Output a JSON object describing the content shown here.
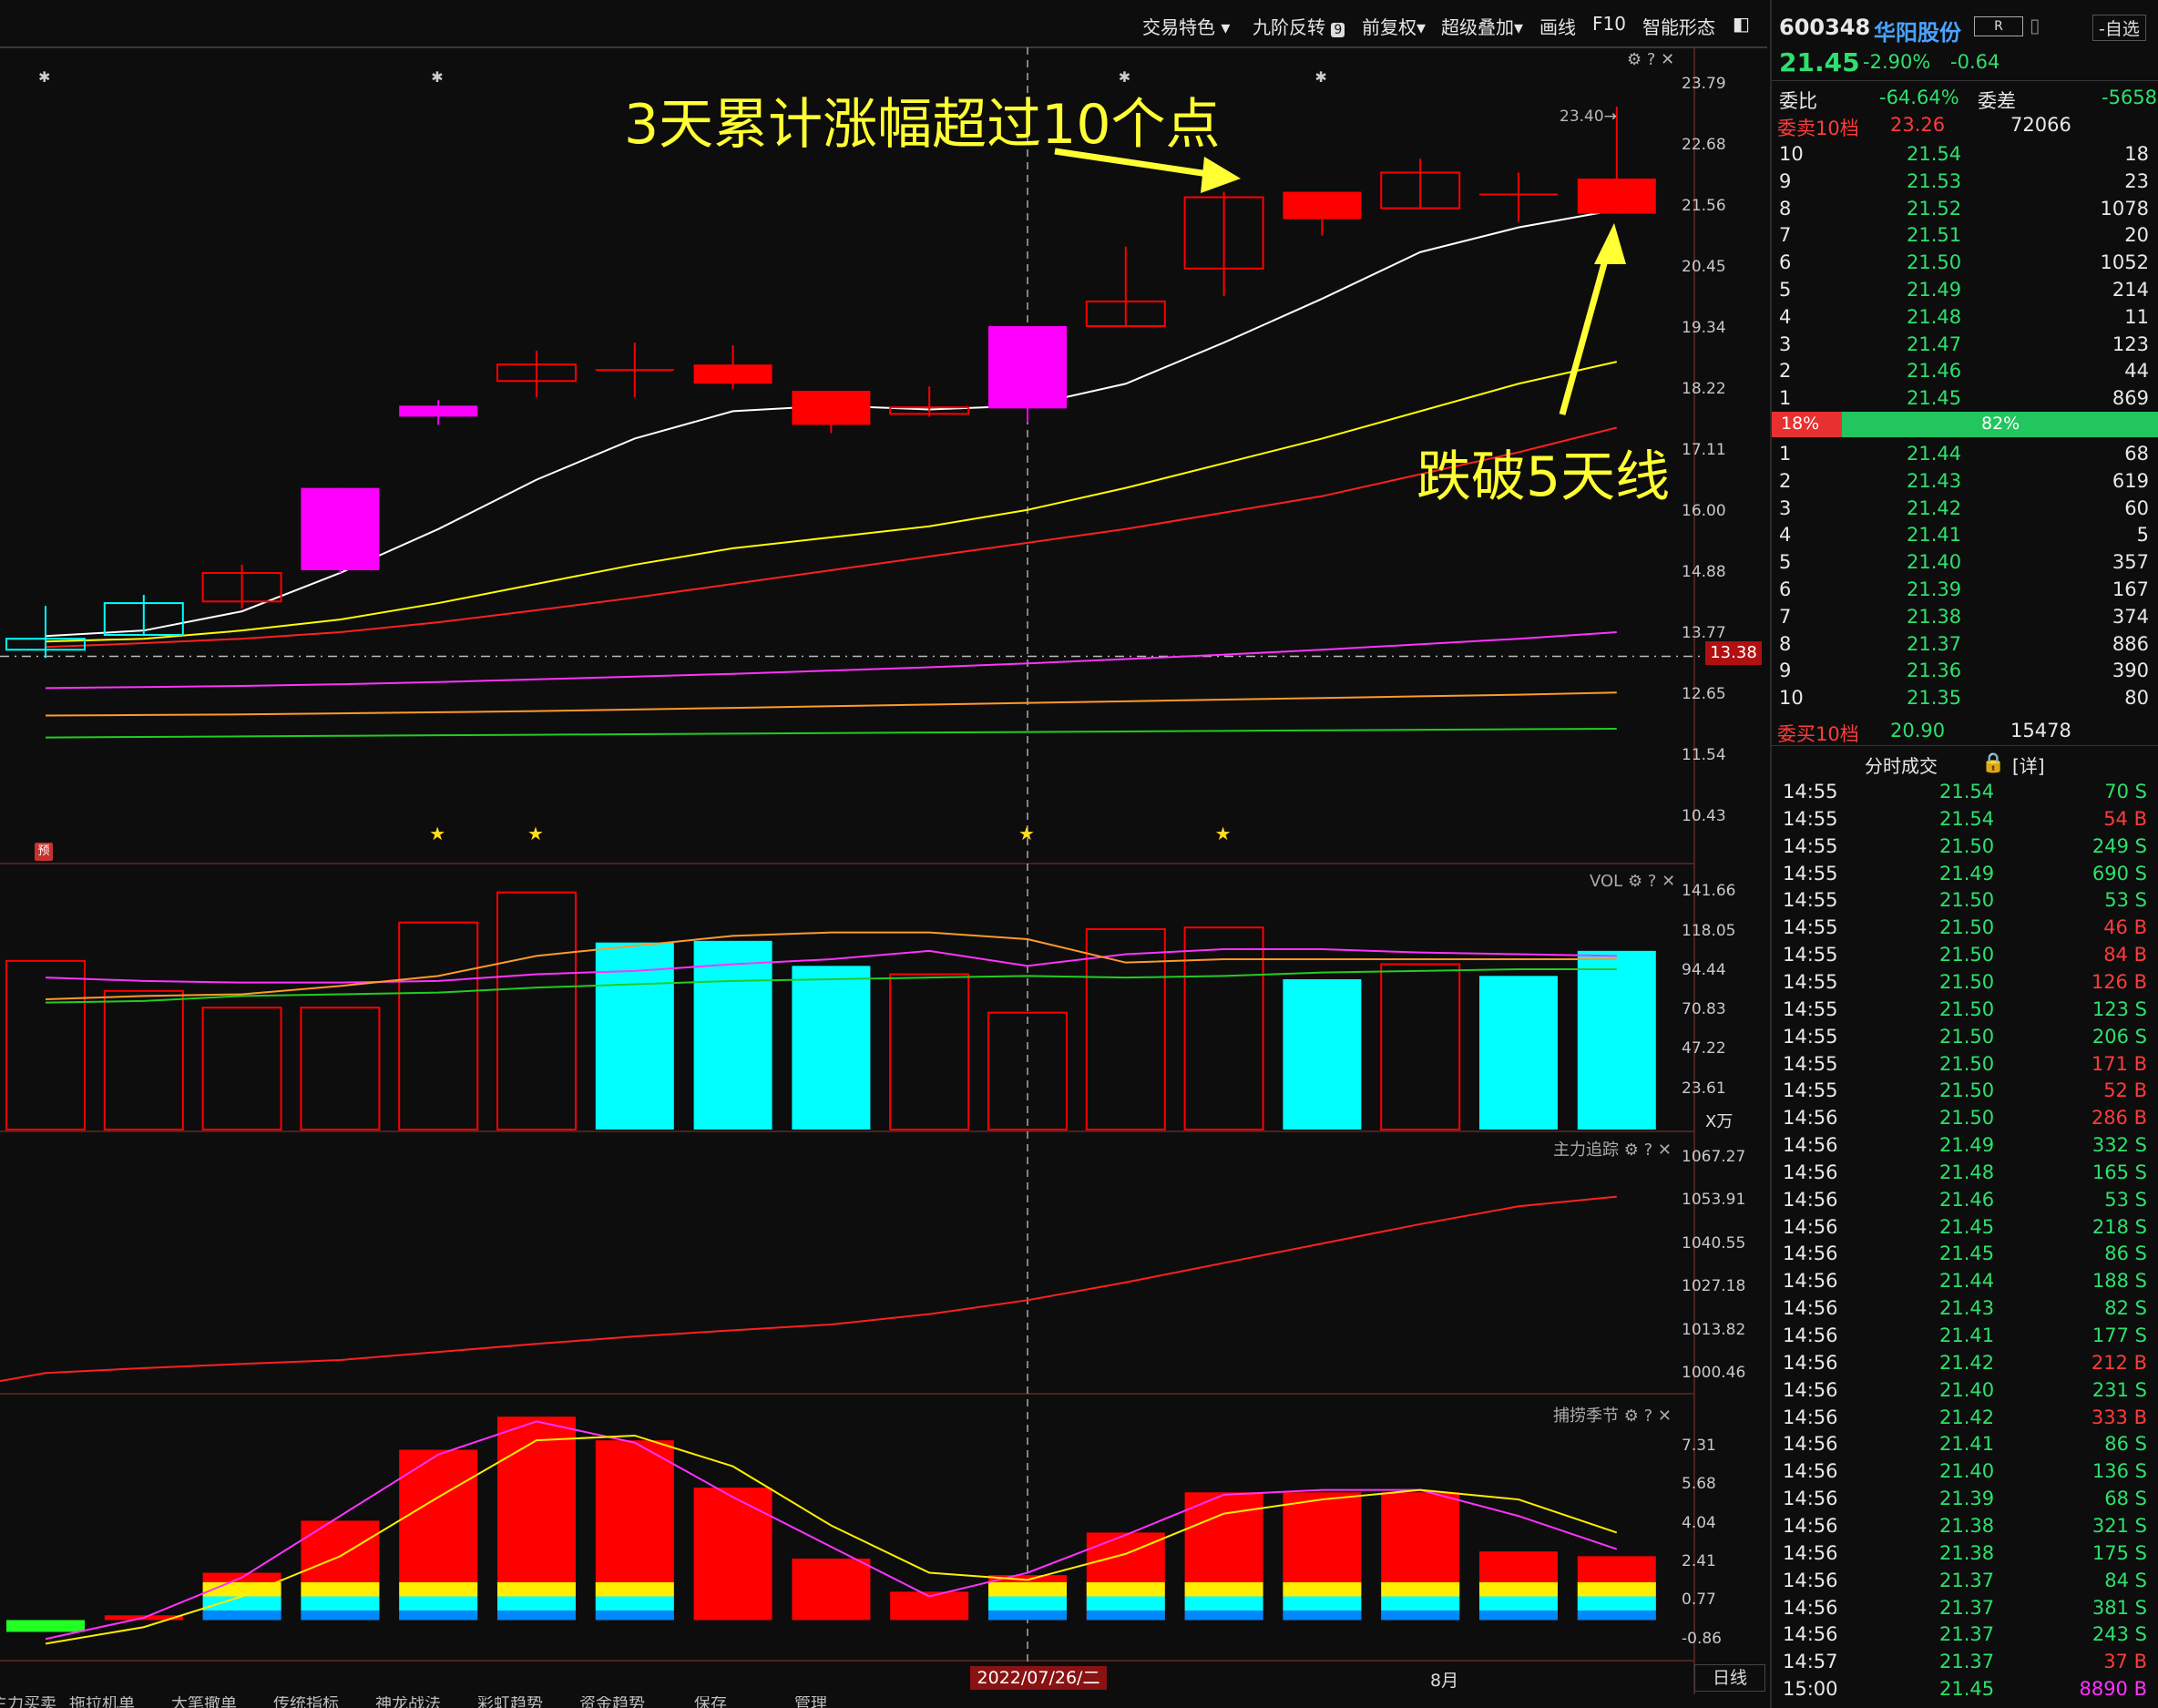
{
  "toolbar": {
    "items": [
      "交易特色",
      "九阶反转",
      "前复权",
      "超级叠加",
      "画线",
      "F10",
      "智能形态"
    ],
    "nine_badge": "9"
  },
  "annotations": {
    "callout_top": "3天累计涨幅超过10个点",
    "callout_right": "跌破5天线",
    "peak_label": "23.40"
  },
  "price_axis": {
    "ticks": [
      "23.79",
      "22.68",
      "21.56",
      "20.45",
      "19.34",
      "18.22",
      "17.11",
      "16.00",
      "14.88",
      "13.77",
      "12.65",
      "11.54",
      "10.43"
    ],
    "current_line": "13.38"
  },
  "vol_pane": {
    "label": "VOL",
    "ticks": [
      "141.66",
      "118.05",
      "94.44",
      "70.83",
      "47.22",
      "23.61"
    ],
    "unit": "X万"
  },
  "main_force_pane": {
    "label": "主力追踪",
    "ticks": [
      "1067.27",
      "1053.91",
      "1040.55",
      "1027.18",
      "1013.82",
      "1000.46"
    ]
  },
  "season_pane": {
    "label": "捕捞季节",
    "ticks": [
      "7.31",
      "5.68",
      "4.04",
      "2.41",
      "0.77",
      "-0.86"
    ]
  },
  "time_axis": {
    "cursor_date": "2022/07/26/二",
    "month_label": "8月",
    "period": "日线"
  },
  "bottom_tabs": [
    "主力买卖",
    "拖拉机单",
    "大笔撤单",
    "传统指标",
    "神龙战法",
    "彩虹趋势",
    "资金趋势",
    "保存",
    "管理"
  ],
  "markers": {
    "yu": "预"
  },
  "stock": {
    "code": "600348",
    "name": "华阳股份",
    "r_badge": "R",
    "watch_button": "-自选",
    "price": "21.45",
    "change_pct": "-2.90%",
    "change": "-0.64",
    "weibi_label": "委比",
    "weibi": "-64.64%",
    "weicha_label": "委差",
    "weicha": "-5658",
    "sell_header": "委卖10档",
    "sell_header_price": "23.26",
    "sell_header_vol": "72066",
    "sells": [
      {
        "lvl": "10",
        "price": "21.54",
        "vol": "18"
      },
      {
        "lvl": "9",
        "price": "21.53",
        "vol": "23"
      },
      {
        "lvl": "8",
        "price": "21.52",
        "vol": "1078"
      },
      {
        "lvl": "7",
        "price": "21.51",
        "vol": "20"
      },
      {
        "lvl": "6",
        "price": "21.50",
        "vol": "1052"
      },
      {
        "lvl": "5",
        "price": "21.49",
        "vol": "214"
      },
      {
        "lvl": "4",
        "price": "21.48",
        "vol": "11"
      },
      {
        "lvl": "3",
        "price": "21.47",
        "vol": "123"
      },
      {
        "lvl": "2",
        "price": "21.46",
        "vol": "44"
      },
      {
        "lvl": "1",
        "price": "21.45",
        "vol": "869"
      }
    ],
    "ratio_sell": "18%",
    "ratio_buy": "82%",
    "ratio_sell_fraction": 0.18,
    "buys": [
      {
        "lvl": "1",
        "price": "21.44",
        "vol": "68"
      },
      {
        "lvl": "2",
        "price": "21.43",
        "vol": "619"
      },
      {
        "lvl": "3",
        "price": "21.42",
        "vol": "60"
      },
      {
        "lvl": "4",
        "price": "21.41",
        "vol": "5"
      },
      {
        "lvl": "5",
        "price": "21.40",
        "vol": "357"
      },
      {
        "lvl": "6",
        "price": "21.39",
        "vol": "167"
      },
      {
        "lvl": "7",
        "price": "21.38",
        "vol": "374"
      },
      {
        "lvl": "8",
        "price": "21.37",
        "vol": "886"
      },
      {
        "lvl": "9",
        "price": "21.36",
        "vol": "390"
      },
      {
        "lvl": "10",
        "price": "21.35",
        "vol": "80"
      }
    ],
    "buy_header": "委买10档",
    "buy_header_price": "20.90",
    "buy_header_vol": "15478",
    "ticks_header": "分时成交",
    "ticks_detail": "[详]",
    "ticks": [
      {
        "t": "14:55",
        "p": "21.54",
        "v": "70",
        "s": "S",
        "c": "green"
      },
      {
        "t": "14:55",
        "p": "21.54",
        "v": "54",
        "s": "B",
        "c": "red"
      },
      {
        "t": "14:55",
        "p": "21.50",
        "v": "249",
        "s": "S",
        "c": "green"
      },
      {
        "t": "14:55",
        "p": "21.49",
        "v": "690",
        "s": "S",
        "c": "green"
      },
      {
        "t": "14:55",
        "p": "21.50",
        "v": "53",
        "s": "S",
        "c": "green"
      },
      {
        "t": "14:55",
        "p": "21.50",
        "v": "46",
        "s": "B",
        "c": "red"
      },
      {
        "t": "14:55",
        "p": "21.50",
        "v": "84",
        "s": "B",
        "c": "red"
      },
      {
        "t": "14:55",
        "p": "21.50",
        "v": "126",
        "s": "B",
        "c": "red"
      },
      {
        "t": "14:55",
        "p": "21.50",
        "v": "123",
        "s": "S",
        "c": "green"
      },
      {
        "t": "14:55",
        "p": "21.50",
        "v": "206",
        "s": "S",
        "c": "green"
      },
      {
        "t": "14:55",
        "p": "21.50",
        "v": "171",
        "s": "B",
        "c": "red"
      },
      {
        "t": "14:55",
        "p": "21.50",
        "v": "52",
        "s": "B",
        "c": "red"
      },
      {
        "t": "14:56",
        "p": "21.50",
        "v": "286",
        "s": "B",
        "c": "red"
      },
      {
        "t": "14:56",
        "p": "21.49",
        "v": "332",
        "s": "S",
        "c": "green"
      },
      {
        "t": "14:56",
        "p": "21.48",
        "v": "165",
        "s": "S",
        "c": "green"
      },
      {
        "t": "14:56",
        "p": "21.46",
        "v": "53",
        "s": "S",
        "c": "green"
      },
      {
        "t": "14:56",
        "p": "21.45",
        "v": "218",
        "s": "S",
        "c": "green"
      },
      {
        "t": "14:56",
        "p": "21.45",
        "v": "86",
        "s": "S",
        "c": "green"
      },
      {
        "t": "14:56",
        "p": "21.44",
        "v": "188",
        "s": "S",
        "c": "green"
      },
      {
        "t": "14:56",
        "p": "21.43",
        "v": "82",
        "s": "S",
        "c": "green"
      },
      {
        "t": "14:56",
        "p": "21.41",
        "v": "177",
        "s": "S",
        "c": "green"
      },
      {
        "t": "14:56",
        "p": "21.42",
        "v": "212",
        "s": "B",
        "c": "red"
      },
      {
        "t": "14:56",
        "p": "21.40",
        "v": "231",
        "s": "S",
        "c": "green"
      },
      {
        "t": "14:56",
        "p": "21.42",
        "v": "333",
        "s": "B",
        "c": "red"
      },
      {
        "t": "14:56",
        "p": "21.41",
        "v": "86",
        "s": "S",
        "c": "green"
      },
      {
        "t": "14:56",
        "p": "21.40",
        "v": "136",
        "s": "S",
        "c": "green"
      },
      {
        "t": "14:56",
        "p": "21.39",
        "v": "68",
        "s": "S",
        "c": "green"
      },
      {
        "t": "14:56",
        "p": "21.38",
        "v": "321",
        "s": "S",
        "c": "green"
      },
      {
        "t": "14:56",
        "p": "21.38",
        "v": "175",
        "s": "S",
        "c": "green"
      },
      {
        "t": "14:56",
        "p": "21.37",
        "v": "84",
        "s": "S",
        "c": "green"
      },
      {
        "t": "14:56",
        "p": "21.37",
        "v": "381",
        "s": "S",
        "c": "green"
      },
      {
        "t": "14:56",
        "p": "21.37",
        "v": "243",
        "s": "S",
        "c": "green"
      },
      {
        "t": "14:57",
        "p": "21.37",
        "v": "37",
        "s": "B",
        "c": "red"
      },
      {
        "t": "15:00",
        "p": "21.45",
        "v": "8890",
        "s": "B",
        "c": "magenta"
      }
    ]
  },
  "colors": {
    "up": "#ff0000",
    "down": "#00ffff",
    "limit": "#ff00ff",
    "ma5": "#ffffff",
    "ma10": "#ffff00",
    "ma20": "#ff2020",
    "ma60": "#ff33ff",
    "ma120": "#ff9a2a",
    "ma250": "#22cc22"
  },
  "chart_data": {
    "type": "candlestick",
    "candles": [
      {
        "o": 13.5,
        "c": 13.7,
        "h": 14.3,
        "l": 13.35,
        "style": "down"
      },
      {
        "o": 13.77,
        "c": 14.35,
        "h": 14.5,
        "l": 13.75,
        "style": "down"
      },
      {
        "o": 14.38,
        "c": 14.9,
        "h": 15.05,
        "l": 14.25,
        "style": "up"
      },
      {
        "o": 14.95,
        "c": 16.45,
        "h": 16.45,
        "l": 14.9,
        "style": "limit"
      },
      {
        "o": 17.75,
        "c": 17.95,
        "h": 18.05,
        "l": 17.6,
        "style": "limit"
      },
      {
        "o": 18.4,
        "c": 18.7,
        "h": 18.95,
        "l": 18.1,
        "style": "up"
      },
      {
        "o": 18.6,
        "c": 18.6,
        "h": 19.1,
        "l": 18.1,
        "style": "doji"
      },
      {
        "o": 18.35,
        "c": 18.7,
        "h": 19.05,
        "l": 18.25,
        "style": "up"
      },
      {
        "o": 17.6,
        "c": 18.22,
        "h": 18.22,
        "l": 17.45,
        "style": "up"
      },
      {
        "o": 17.8,
        "c": 17.92,
        "h": 18.3,
        "l": 17.75,
        "style": "up"
      },
      {
        "o": 17.9,
        "c": 19.4,
        "h": 19.4,
        "l": 17.65,
        "style": "limit"
      },
      {
        "o": 19.4,
        "c": 19.85,
        "h": 20.85,
        "l": 19.4,
        "style": "up"
      },
      {
        "o": 20.45,
        "c": 21.75,
        "h": 21.85,
        "l": 19.95,
        "style": "up"
      },
      {
        "o": 21.35,
        "c": 21.85,
        "h": 21.85,
        "l": 21.05,
        "style": "up"
      },
      {
        "o": 21.55,
        "c": 22.2,
        "h": 22.45,
        "l": 21.55,
        "style": "up"
      },
      {
        "o": 21.8,
        "c": 21.8,
        "h": 22.2,
        "l": 21.3,
        "style": "doji"
      },
      {
        "o": 21.45,
        "c": 22.09,
        "h": 23.4,
        "l": 21.45,
        "style": "up"
      }
    ],
    "ma5": [
      13.75,
      13.85,
      14.2,
      14.9,
      15.7,
      16.6,
      17.35,
      17.85,
      17.95,
      17.88,
      17.95,
      18.35,
      19.1,
      19.9,
      20.75,
      21.2,
      21.52
    ],
    "ma10": [
      13.65,
      13.7,
      13.85,
      14.05,
      14.35,
      14.7,
      15.05,
      15.35,
      15.55,
      15.75,
      16.05,
      16.45,
      16.9,
      17.35,
      17.85,
      18.35,
      18.75
    ],
    "ma20": [
      13.55,
      13.62,
      13.7,
      13.82,
      14.0,
      14.22,
      14.45,
      14.7,
      14.95,
      15.2,
      15.45,
      15.7,
      16.0,
      16.3,
      16.7,
      17.1,
      17.55
    ],
    "ma60": [
      12.8,
      12.82,
      12.84,
      12.87,
      12.91,
      12.96,
      13.01,
      13.06,
      13.12,
      13.18,
      13.25,
      13.33,
      13.41,
      13.5,
      13.6,
      13.7,
      13.82
    ],
    "ma120": [
      12.3,
      12.31,
      12.32,
      12.34,
      12.36,
      12.38,
      12.41,
      12.44,
      12.47,
      12.5,
      12.53,
      12.56,
      12.59,
      12.62,
      12.65,
      12.68,
      12.72
    ],
    "ma250": [
      11.9,
      11.91,
      11.92,
      11.93,
      11.94,
      11.95,
      11.96,
      11.97,
      11.98,
      11.99,
      12.0,
      12.01,
      12.02,
      12.03,
      12.04,
      12.05,
      12.06
    ],
    "volume": [
      101,
      83,
      73,
      73,
      124,
      142,
      112,
      113,
      98,
      93,
      70,
      120,
      121,
      90,
      99,
      92,
      107
    ],
    "volume_style": [
      "up",
      "up",
      "up",
      "up",
      "up",
      "up",
      "down",
      "down",
      "down",
      "up",
      "up",
      "up",
      "up",
      "down",
      "up",
      "down",
      "down"
    ],
    "vol_ma1": [
      91,
      89,
      88,
      88,
      89,
      93,
      95,
      99,
      102,
      107,
      98,
      105,
      108,
      108,
      106,
      105,
      104
    ],
    "vol_ma2": [
      78,
      80,
      81,
      86,
      92,
      104,
      110,
      116,
      118,
      118,
      114,
      100,
      102,
      102,
      102,
      102,
      102
    ],
    "vol_ma3": [
      76,
      77,
      80,
      81,
      82,
      85,
      87,
      89,
      90,
      91,
      92,
      91,
      92,
      94,
      95,
      96,
      96
    ],
    "main_force": [
      1001.0,
      1002.5,
      1003.8,
      1005.0,
      1007.5,
      1010.0,
      1012.3,
      1014.2,
      1016.0,
      1019.2,
      1023.5,
      1029.0,
      1035.0,
      1041.0,
      1047.0,
      1052.5,
      1055.5
    ],
    "season_bar": [
      -0.5,
      0.2,
      2.0,
      4.2,
      7.2,
      8.6,
      7.6,
      5.6,
      2.6,
      1.2,
      1.9,
      3.7,
      5.4,
      5.4,
      5.4,
      2.9,
      2.7
    ],
    "season_line1": [
      -0.8,
      0.1,
      1.8,
      4.4,
      7.0,
      8.4,
      7.5,
      5.2,
      3.1,
      1.0,
      2.0,
      3.6,
      5.3,
      5.5,
      5.5,
      4.4,
      3.0
    ],
    "season_line2": [
      -1.0,
      -0.3,
      1.0,
      2.7,
      5.2,
      7.6,
      7.8,
      6.5,
      4.0,
      2.0,
      1.7,
      2.8,
      4.5,
      5.1,
      5.5,
      5.1,
      3.7
    ],
    "price_range": [
      9.9,
      24.35
    ],
    "vol_range": [
      0,
      150
    ],
    "main_force_range": [
      996,
      1072
    ],
    "season_range": [
      -1.6,
      8.8
    ]
  }
}
